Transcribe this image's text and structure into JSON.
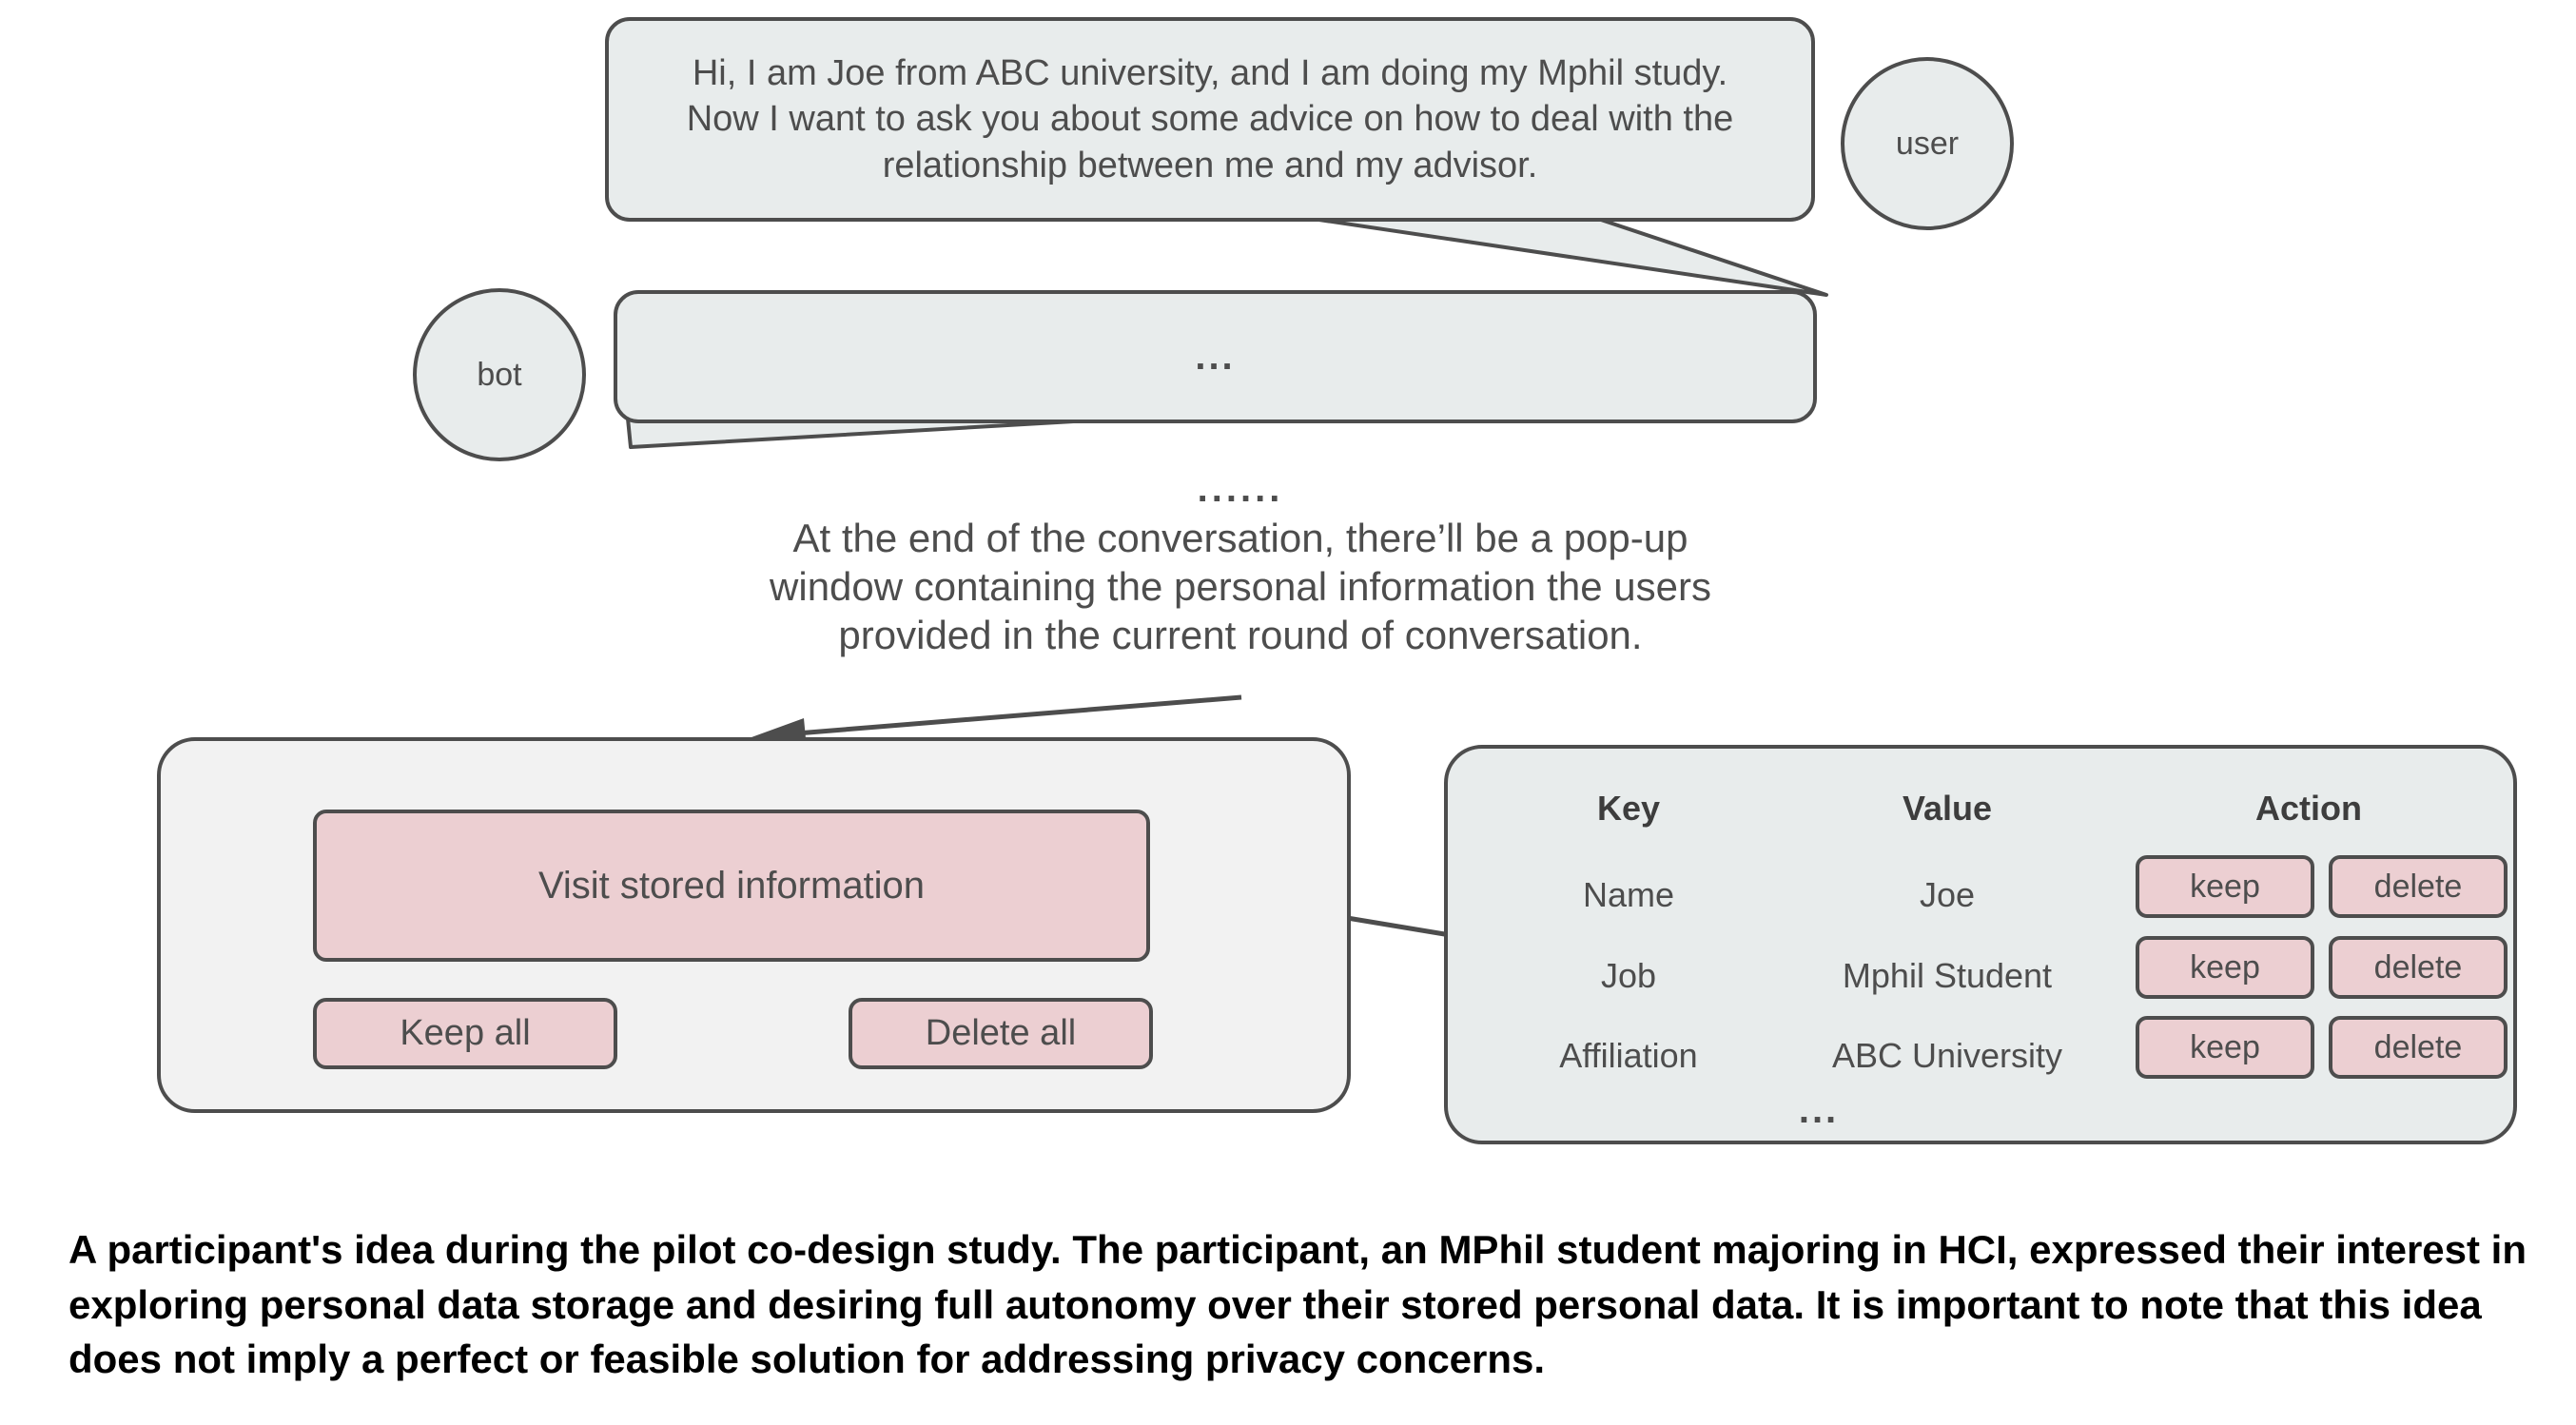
{
  "conversation": {
    "user_avatar_label": "user",
    "bot_avatar_label": "bot",
    "user_message": "Hi, I am Joe from ABC university, and I am doing my Mphil study.\nNow I want to ask you about some advice on how to deal with the\nrelationship between me and my advisor.",
    "bot_message": "...",
    "ellipsis_between": "......",
    "note": "At the end of the conversation, there’ll be a pop-up\nwindow containing the personal information the users\nprovided in the current round of conversation."
  },
  "popup_panel": {
    "visit_button_label": "Visit stored information",
    "keep_all_label": "Keep all",
    "delete_all_label": "Delete all"
  },
  "storage_table": {
    "headers": {
      "key": "Key",
      "value": "Value",
      "action": "Action"
    },
    "rows": [
      {
        "key": "Name",
        "value": "Joe",
        "keep": "keep",
        "delete": "delete"
      },
      {
        "key": "Job",
        "value": "Mphil Student",
        "keep": "keep",
        "delete": "delete"
      },
      {
        "key": "Affiliation",
        "value": "ABC University",
        "keep": "keep",
        "delete": "delete"
      }
    ],
    "more_indicator": "..."
  },
  "caption": {
    "text": "A participant's idea during the pilot co-design study. The participant, an MPhil student majoring in HCI, expressed their interest in exploring personal data storage and desiring full autonomy over their stored personal data. It is important to note that this idea does not imply a perfect or feasible solution for addressing privacy concerns."
  },
  "colors": {
    "bubble_fill": "#e8ecec",
    "panel_left_fill": "#f2f2f2",
    "pink_fill": "#eccfd2",
    "stroke": "#4d4d4d",
    "text": "#4d4d4d",
    "caption_text": "#000000"
  }
}
